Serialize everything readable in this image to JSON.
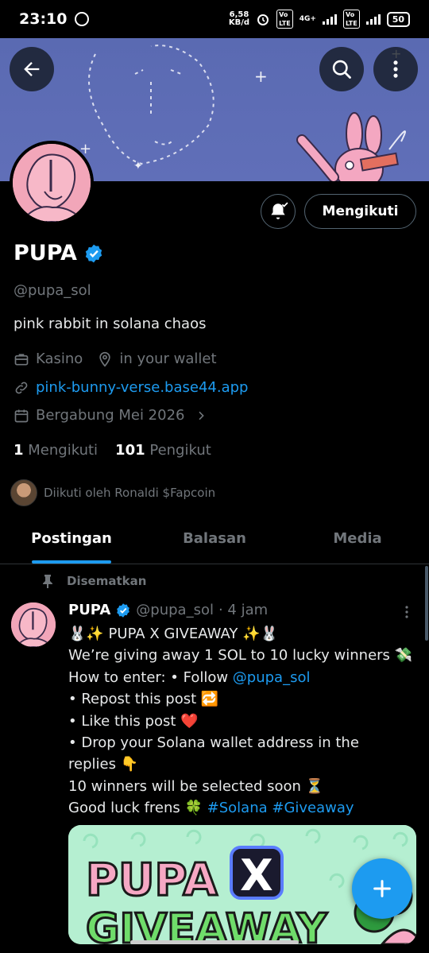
{
  "status_bar": {
    "time": "23:10",
    "net_speed_value": "6,58",
    "net_speed_unit": "KB/d",
    "battery": "50"
  },
  "header": {
    "back_icon": "arrow-left-icon",
    "search_icon": "search-icon",
    "more_icon": "more-vertical-icon"
  },
  "profile": {
    "follow_label": "Mengikuti",
    "name": "PUPA",
    "handle": "@pupa_sol",
    "bio": "pink rabbit in solana chaos",
    "category": "Kasino",
    "location": "in your wallet",
    "website": "pink-bunny-verse.base44.app",
    "joined": "Bergabung Mei 2026",
    "following_count": "1",
    "following_label": "Mengikuti",
    "followers_count": "101",
    "followers_label": "Pengikut",
    "followed_by": "Diikuti oleh Ronaldi $Fapcoin"
  },
  "tabs": [
    {
      "label": "Postingan",
      "active": true
    },
    {
      "label": "Balasan",
      "active": false
    },
    {
      "label": "Media",
      "active": false
    }
  ],
  "post": {
    "pinned_label": "Disematkan",
    "name": "PUPA",
    "handle": "@pupa_sol",
    "time": "· 4 jam",
    "lines": {
      "l1": "🐰✨ PUPA X GIVEAWAY ✨🐰",
      "l2": "We’re giving away 1 SOL to 10 lucky winners 💸",
      "l3_pre": "How to enter: • Follow ",
      "l3_mention": "@pupa_sol",
      "l4": "• Repost this post 🔁",
      "l5": "• Like this post ❤️",
      "l6": "• Drop your Solana wallet address in the",
      "l7": "replies 👇",
      "l8": "10 winners will be selected soon ⏳",
      "l9_pre": "Good luck frens 🍀 ",
      "l9_tag1": "#Solana",
      "l9_tag2": "#Giveaway"
    },
    "media": {
      "word1": "PUPA",
      "letter": "X",
      "word2": "GIVEAWAY"
    }
  },
  "colors": {
    "accent": "#1d9bf0",
    "banner": "#5e6db6",
    "pink": "#f2a6b9",
    "muted": "#71767b"
  }
}
